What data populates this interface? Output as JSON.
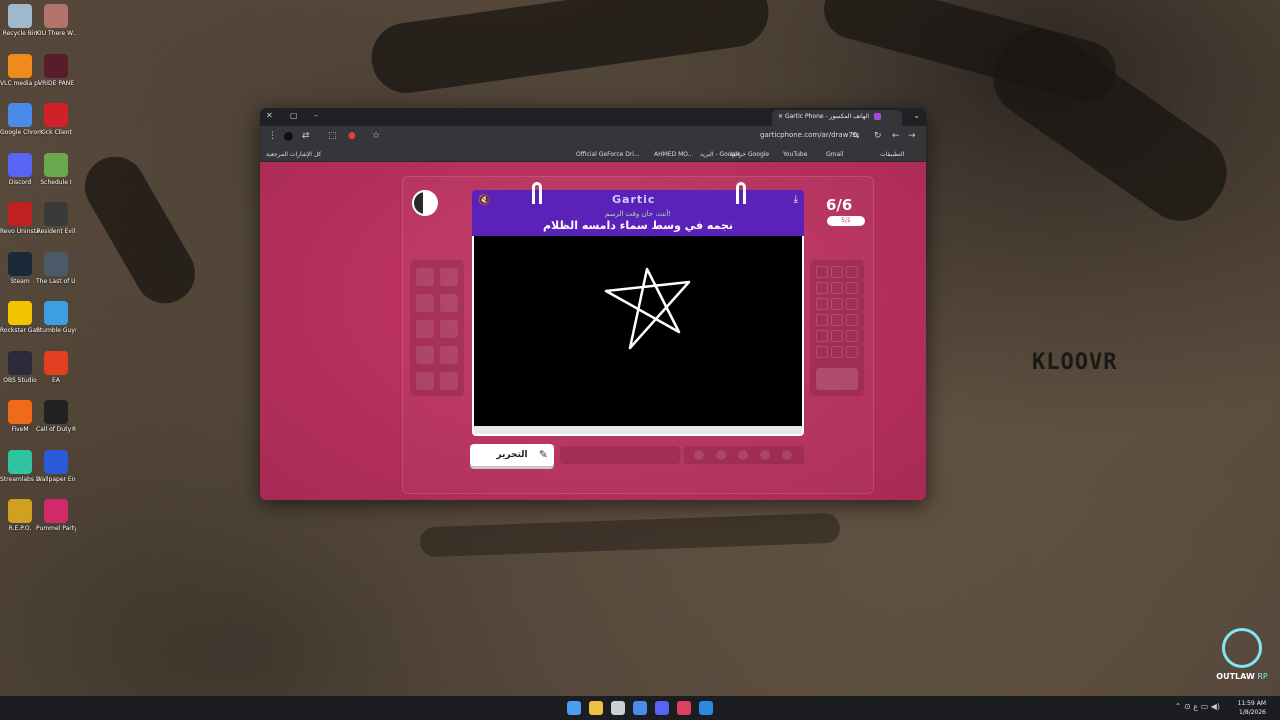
{
  "desktop": {
    "icons": [
      {
        "label": "Recycle Bin",
        "color": "#9fb8cc"
      },
      {
        "label": "KIU There W...",
        "color": "#b0746a"
      },
      {
        "label": "VLC media player",
        "color": "#f08a1c"
      },
      {
        "label": "VRIDE PANE",
        "color": "#5a1c2a"
      },
      {
        "label": "Google Chrome",
        "color": "#4a8ae8"
      },
      {
        "label": "Kick Client",
        "color": "#d0202a"
      },
      {
        "label": "Discord",
        "color": "#5865f2"
      },
      {
        "label": "Schedule I",
        "color": "#6aa84f"
      },
      {
        "label": "Revo Uninstaller",
        "color": "#c02020"
      },
      {
        "label": "Resident Evil",
        "color": "#3a3a3a"
      },
      {
        "label": "Steam",
        "color": "#1b2838"
      },
      {
        "label": "The Last of Us™ Part I...",
        "color": "#4a5a6a"
      },
      {
        "label": "Rockstar Games ...",
        "color": "#f5c400"
      },
      {
        "label": "Stumble Guys",
        "color": "#3aa0e0"
      },
      {
        "label": "OBS Studio",
        "color": "#2a2a3a"
      },
      {
        "label": "EA",
        "color": "#e04020"
      },
      {
        "label": "FiveM",
        "color": "#f06a1a"
      },
      {
        "label": "Call of Duty®",
        "color": "#222222"
      },
      {
        "label": "Streamlabs Desktop",
        "color": "#31c3a2"
      },
      {
        "label": "Wallpaper Engine",
        "color": "#2a5ad8"
      },
      {
        "label": "R.E.P.O.",
        "color": "#d0a020"
      },
      {
        "label": "Pummel Party",
        "color": "#d02a6a"
      }
    ],
    "watermark": "KLOOVR",
    "logo_text_a": "OUTLAW",
    "logo_text_b": "RP"
  },
  "browser": {
    "window_controls": {
      "close": "✕",
      "restore": "▢",
      "minimize": "–"
    },
    "new_tab": "+",
    "tab_title": "Gartic Phone - الهاتف المكسور",
    "tab_close": "✕",
    "url": "garticphone.com/ar/draw76",
    "bookmarks": [
      "Official GeForce Dri...",
      "AHMED MO...",
      "البريد - Google",
      "خرائط Google",
      "YouTube",
      "Gmail",
      "التطبيقات"
    ],
    "all_bookmarks": "كل الإشارات المرجعية"
  },
  "game": {
    "logo": "Gartic",
    "hint": "أنت، حان وقت الرسم!",
    "prompt": "نجمه في وسط سماء دامسه الظلام",
    "counter": "6/6",
    "sub_counter": "5/1",
    "edit_label": "التحرير",
    "mute_icon": "🔇",
    "download_icon": "⤓",
    "pen_icon": "✎"
  },
  "taskbar": {
    "time": "11:59 AM",
    "date": "1/8/2026",
    "lang": "ع",
    "apps": [
      {
        "name": "start",
        "color": "#4aa0f0"
      },
      {
        "name": "explorer",
        "color": "#f0c040"
      },
      {
        "name": "steam",
        "color": "#c8d0d8"
      },
      {
        "name": "chrome",
        "color": "#4a8ae8"
      },
      {
        "name": "discord",
        "color": "#5865f2"
      },
      {
        "name": "gear",
        "color": "#e04060"
      },
      {
        "name": "vscode",
        "color": "#2a8ae0"
      }
    ]
  }
}
